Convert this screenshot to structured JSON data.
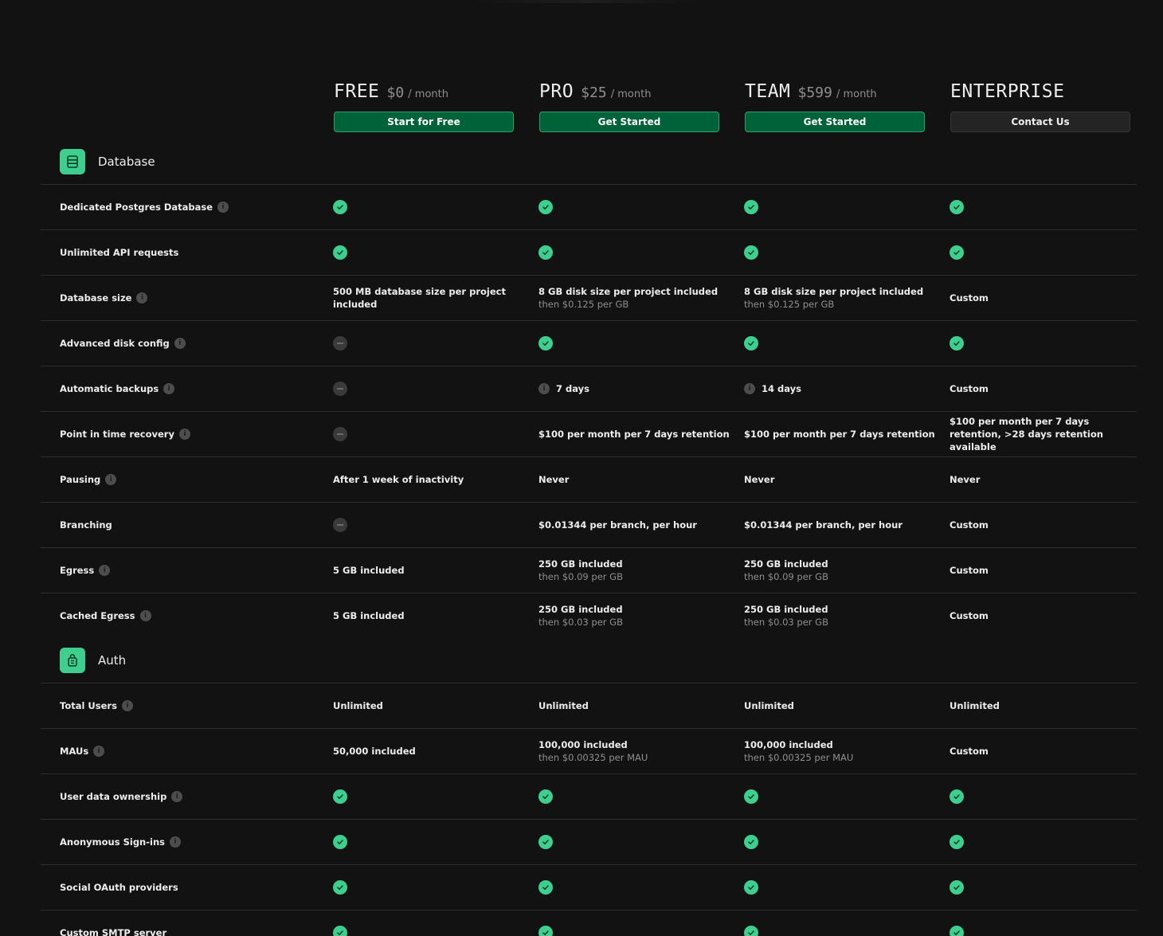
{
  "plans": [
    {
      "name": "FREE",
      "price": "$0",
      "period": "/ month",
      "button": "Start for Free"
    },
    {
      "name": "PRO",
      "price": "$25",
      "period": "/ month",
      "button": "Get Started"
    },
    {
      "name": "TEAM",
      "price": "$599",
      "period": "/ month",
      "button": "Get Started"
    },
    {
      "name": "ENTERPRISE",
      "price": "",
      "period": "",
      "button": "Contact Us"
    }
  ],
  "colors": {
    "accent": "#3ecf8e",
    "button_green": "#006239",
    "background": "#121212"
  },
  "sections": [
    {
      "title": "Database",
      "icon": "database-icon",
      "rows": [
        {
          "feature": "Dedicated Postgres Database",
          "info": true,
          "cells": [
            {
              "type": "check"
            },
            {
              "type": "check"
            },
            {
              "type": "check"
            },
            {
              "type": "check"
            }
          ]
        },
        {
          "feature": "Unlimited API requests",
          "info": false,
          "cells": [
            {
              "type": "check"
            },
            {
              "type": "check"
            },
            {
              "type": "check"
            },
            {
              "type": "check"
            }
          ]
        },
        {
          "feature": "Database size",
          "info": true,
          "cells": [
            {
              "type": "text",
              "main": "500 MB database size per project included",
              "sub": ""
            },
            {
              "type": "text",
              "main": "8 GB disk size per project included",
              "sub": "then $0.125 per GB"
            },
            {
              "type": "text",
              "main": "8 GB disk size per project included",
              "sub": "then $0.125 per GB"
            },
            {
              "type": "text",
              "main": "Custom",
              "sub": ""
            }
          ]
        },
        {
          "feature": "Advanced disk config",
          "info": true,
          "cells": [
            {
              "type": "dash"
            },
            {
              "type": "check"
            },
            {
              "type": "check"
            },
            {
              "type": "check"
            }
          ]
        },
        {
          "feature": "Automatic backups",
          "info": true,
          "cells": [
            {
              "type": "dash"
            },
            {
              "type": "info-text",
              "main": "7 days"
            },
            {
              "type": "info-text",
              "main": "14 days"
            },
            {
              "type": "text",
              "main": "Custom",
              "sub": ""
            }
          ]
        },
        {
          "feature": "Point in time recovery",
          "info": true,
          "cells": [
            {
              "type": "dash"
            },
            {
              "type": "text",
              "main": "$100 per month per 7 days retention",
              "sub": ""
            },
            {
              "type": "text",
              "main": "$100 per month per 7 days retention",
              "sub": ""
            },
            {
              "type": "text",
              "main": "$100 per month per 7 days retention, >28 days retention available",
              "sub": ""
            }
          ]
        },
        {
          "feature": "Pausing",
          "info": true,
          "cells": [
            {
              "type": "text",
              "main": "After 1 week of inactivity",
              "sub": ""
            },
            {
              "type": "text",
              "main": "Never",
              "sub": ""
            },
            {
              "type": "text",
              "main": "Never",
              "sub": ""
            },
            {
              "type": "text",
              "main": "Never",
              "sub": ""
            }
          ]
        },
        {
          "feature": "Branching",
          "info": false,
          "cells": [
            {
              "type": "dash"
            },
            {
              "type": "text",
              "main": "$0.01344 per branch, per hour",
              "sub": ""
            },
            {
              "type": "text",
              "main": "$0.01344 per branch, per hour",
              "sub": ""
            },
            {
              "type": "text",
              "main": "Custom",
              "sub": ""
            }
          ]
        },
        {
          "feature": "Egress",
          "info": true,
          "cells": [
            {
              "type": "text",
              "main": "5 GB included",
              "sub": ""
            },
            {
              "type": "text",
              "main": "250 GB included",
              "sub": "then $0.09 per GB"
            },
            {
              "type": "text",
              "main": "250 GB included",
              "sub": "then $0.09 per GB"
            },
            {
              "type": "text",
              "main": "Custom",
              "sub": ""
            }
          ]
        },
        {
          "feature": "Cached Egress",
          "info": true,
          "cells": [
            {
              "type": "text",
              "main": "5 GB included",
              "sub": ""
            },
            {
              "type": "text",
              "main": "250 GB included",
              "sub": "then $0.03 per GB"
            },
            {
              "type": "text",
              "main": "250 GB included",
              "sub": "then $0.03 per GB"
            },
            {
              "type": "text",
              "main": "Custom",
              "sub": ""
            }
          ]
        }
      ]
    },
    {
      "title": "Auth",
      "icon": "lock-icon",
      "rows": [
        {
          "feature": "Total Users",
          "info": true,
          "cells": [
            {
              "type": "text",
              "main": "Unlimited",
              "sub": ""
            },
            {
              "type": "text",
              "main": "Unlimited",
              "sub": ""
            },
            {
              "type": "text",
              "main": "Unlimited",
              "sub": ""
            },
            {
              "type": "text",
              "main": "Unlimited",
              "sub": ""
            }
          ]
        },
        {
          "feature": "MAUs",
          "info": true,
          "cells": [
            {
              "type": "text",
              "main": "50,000 included",
              "sub": ""
            },
            {
              "type": "text",
              "main": "100,000 included",
              "sub": "then $0.00325 per MAU"
            },
            {
              "type": "text",
              "main": "100,000 included",
              "sub": "then $0.00325 per MAU"
            },
            {
              "type": "text",
              "main": "Custom",
              "sub": ""
            }
          ]
        },
        {
          "feature": "User data ownership",
          "info": true,
          "cells": [
            {
              "type": "check"
            },
            {
              "type": "check"
            },
            {
              "type": "check"
            },
            {
              "type": "check"
            }
          ]
        },
        {
          "feature": "Anonymous Sign-ins",
          "info": true,
          "cells": [
            {
              "type": "check"
            },
            {
              "type": "check"
            },
            {
              "type": "check"
            },
            {
              "type": "check"
            }
          ]
        },
        {
          "feature": "Social OAuth providers",
          "info": false,
          "cells": [
            {
              "type": "check"
            },
            {
              "type": "check"
            },
            {
              "type": "check"
            },
            {
              "type": "check"
            }
          ]
        },
        {
          "feature": "Custom SMTP server",
          "info": false,
          "cells": [
            {
              "type": "check"
            },
            {
              "type": "check"
            },
            {
              "type": "check"
            },
            {
              "type": "check"
            }
          ]
        }
      ]
    }
  ]
}
